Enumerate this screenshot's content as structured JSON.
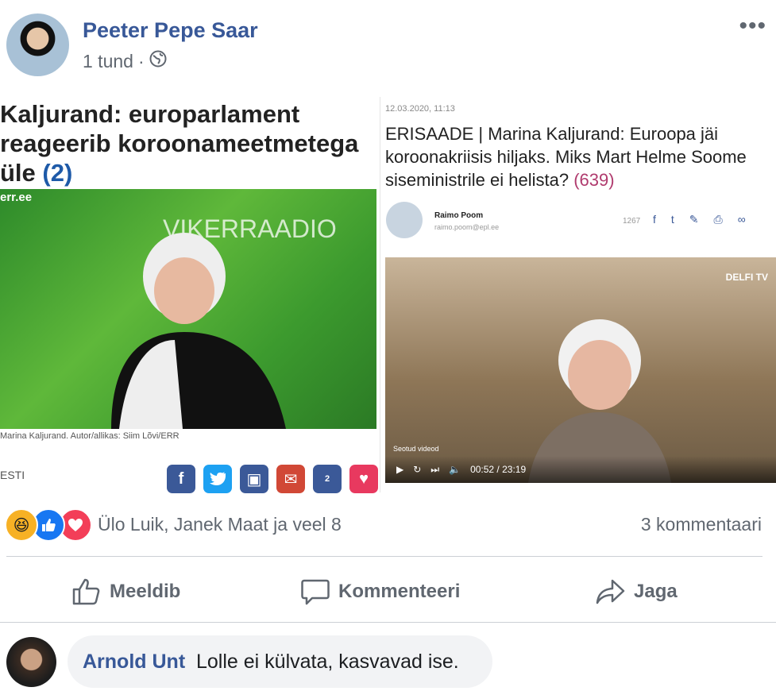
{
  "post": {
    "author": "Peeter Pepe Saar",
    "time": "1 tund",
    "separator": "·",
    "privacy_icon": "globe-icon",
    "menu_icon": "more-options-icon",
    "menu_glyph": "•••"
  },
  "images": {
    "left": {
      "headline": "Kaljurand: europarlament reageerib koroonameetmetega üle",
      "headline_count": "(2)",
      "source_tag": "err.ee",
      "photo_text_1": "VIKERRAADIO",
      "caption": "Marina Kaljurand. Autor/allikas: Siim Lõvi/ERR",
      "section": "ESTI",
      "share_icons": [
        "facebook-icon",
        "twitter-icon",
        "print-icon",
        "email-icon",
        "comments-icon",
        "heart-icon"
      ],
      "share_comment_count": "2"
    },
    "right": {
      "date": "12.03.2020, 11:13",
      "headline": "ERISAADE | Marina Kaljurand: Euroopa jäi koroonakriisis hiljaks. Miks Mart Helme Soome siseministrile ei helista?",
      "headline_count": "(639)",
      "author_name": "Raimo Poom",
      "author_email": "raimo.poom@epl.ee",
      "share_count": "1267",
      "video_label": "Seotud videod",
      "video_brand": "DELFI TV",
      "video_time": "00:52 / 23:19"
    }
  },
  "reactions": {
    "icons": [
      "haha-icon",
      "like-icon",
      "love-icon"
    ],
    "names": "Ülo Luik, Janek Maat ja veel 8",
    "comments": "3 kommentaari"
  },
  "actions": {
    "like": "Meeldib",
    "comment": "Kommenteeri",
    "share": "Jaga"
  },
  "comment": {
    "author": "Arnold Unt",
    "text": "Lolle ei külvata, kasvavad ise."
  },
  "colors": {
    "link_blue": "#385898",
    "secondary_text": "#606770",
    "like_blue": "#1877f2",
    "love_red": "#f33e58",
    "haha_yellow": "#f7b125"
  }
}
